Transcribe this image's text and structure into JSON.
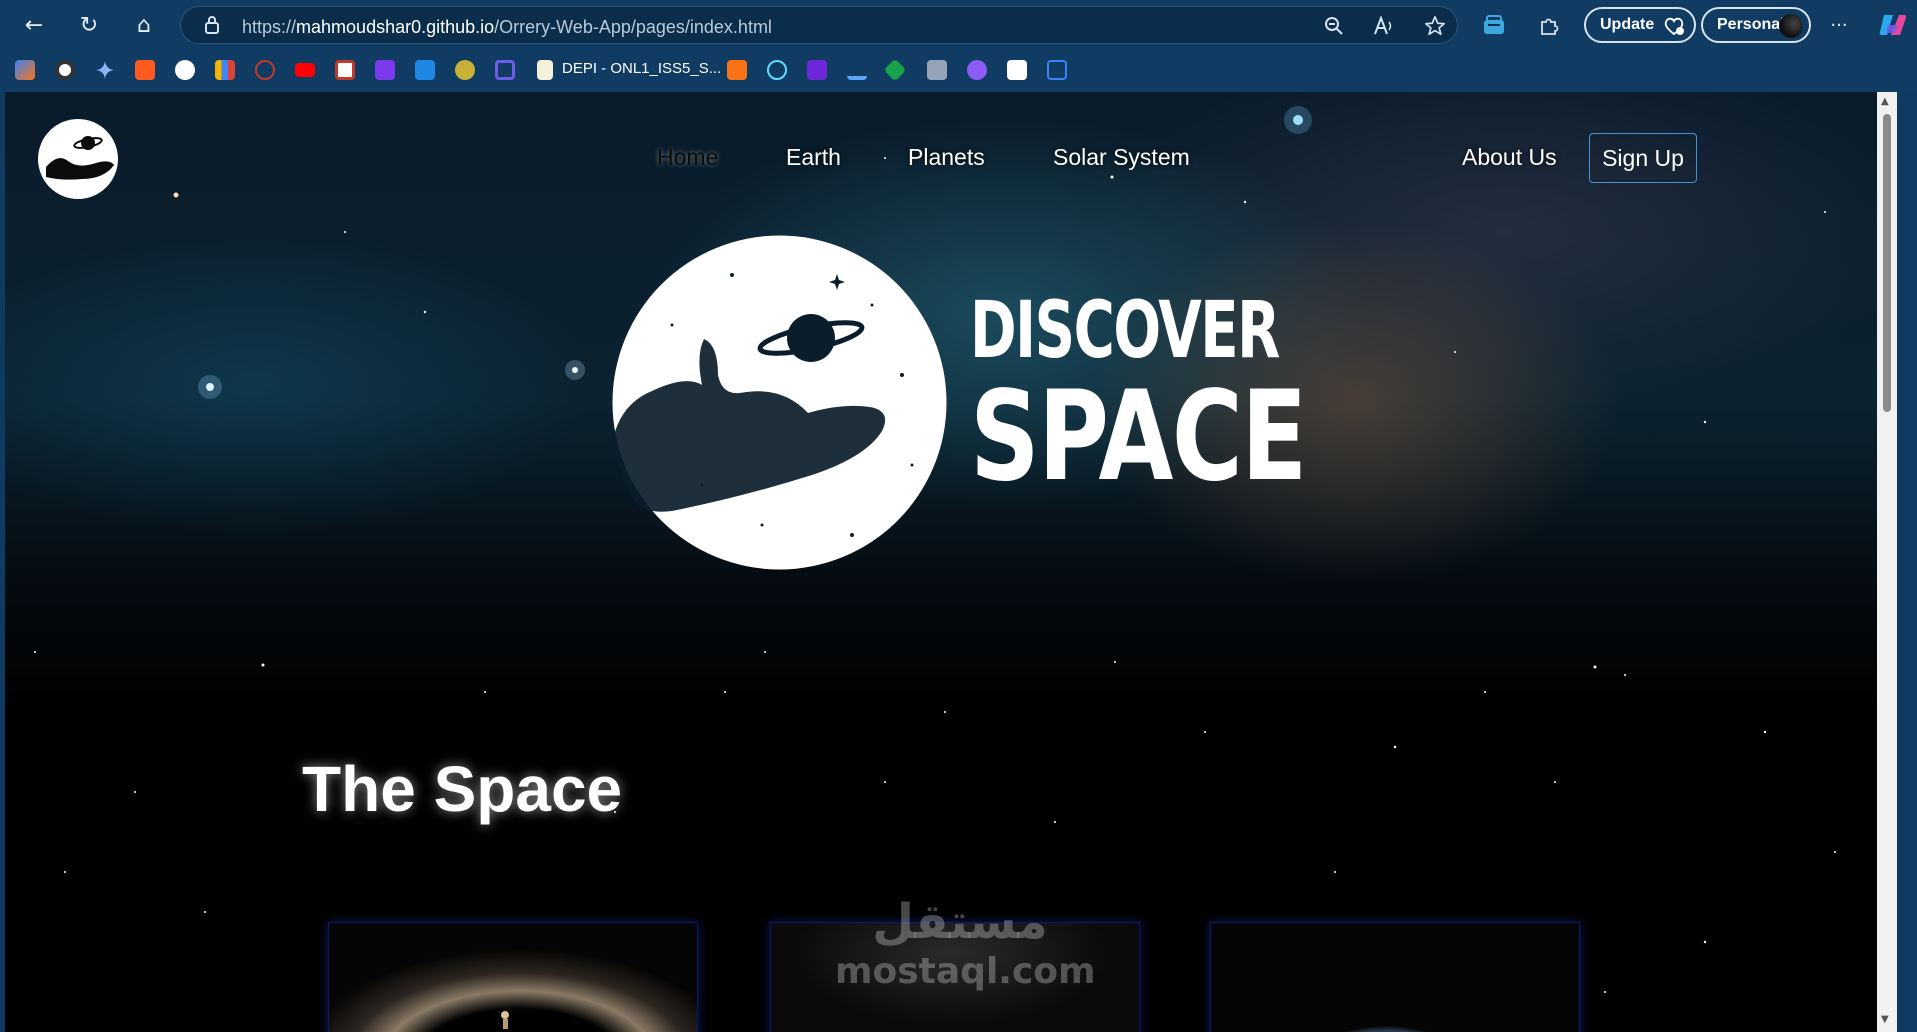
{
  "browser": {
    "url_prefix": "https://",
    "url_host": "mahmoudshar0.github.io",
    "url_path": "/Orrery-Web-App/pages/index.html",
    "update_label": "Update",
    "profile_label": "Personal",
    "more_glyph": "···",
    "back_glyph": "←",
    "refresh_glyph": "↻",
    "home_glyph": "⌂",
    "bookmark_label": "DEPI - ONL1_ISS5_S..."
  },
  "nav": {
    "links": [
      "Home",
      "Earth",
      "Planets",
      "Solar System",
      "About Us"
    ],
    "signup": "Sign Up"
  },
  "hero": {
    "line1": "DISCOVER",
    "line2": "SPACE"
  },
  "section": {
    "title": "The Space"
  },
  "watermark": {
    "arabic": "مستقل",
    "latin": "mostaql.com"
  }
}
